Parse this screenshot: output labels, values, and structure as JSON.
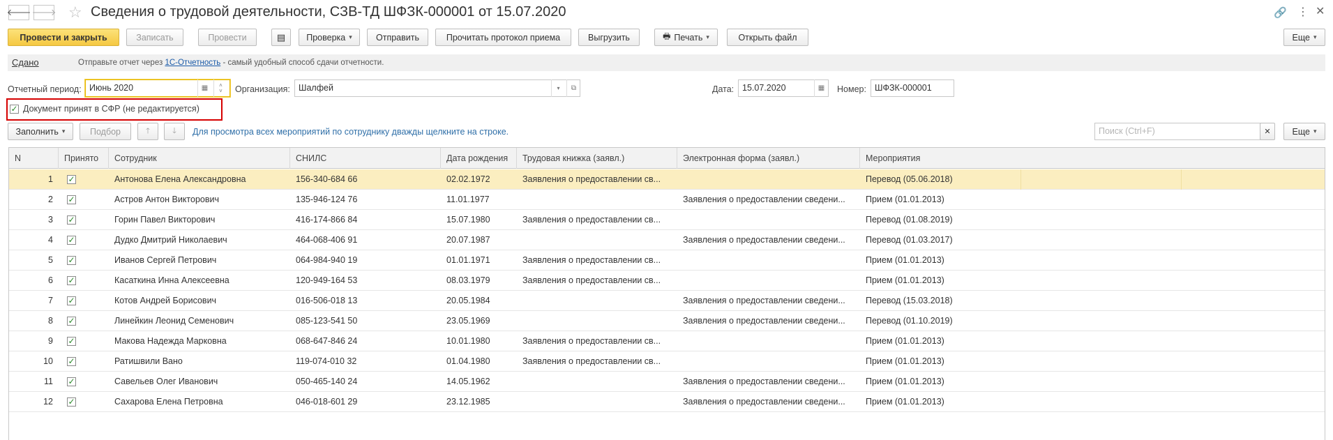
{
  "title": "Сведения о трудовой деятельности, СЗВ-ТД ШФЗК-000001 от 15.07.2020",
  "toolbar": {
    "post_close": "Провести и закрыть",
    "save": "Записать",
    "post": "Провести",
    "check": "Проверка",
    "send": "Отправить",
    "read_protocol": "Прочитать протокол приема",
    "upload": "Выгрузить",
    "print": "Печать",
    "open_file": "Открыть файл",
    "more": "Еще"
  },
  "info": {
    "status": "Сдано",
    "text_before": "Отправьте отчет через",
    "link": "1С-Отчетность",
    "text_after": "- самый удобный способ сдачи отчетности."
  },
  "fields": {
    "period_label": "Отчетный период:",
    "period_value": "Июнь 2020",
    "org_label": "Организация:",
    "org_value": "Шалфей",
    "date_label": "Дата:",
    "date_value": "15.07.2020",
    "number_label": "Номер:",
    "number_value": "ШФЗК-000001"
  },
  "accepted_checkbox": "Документ принят в СФР (не редактируется)",
  "table_toolbar": {
    "fill": "Заполнить",
    "select": "Подбор",
    "hint": "Для просмотра всех мероприятий по сотруднику дважды щелкните на строке.",
    "search_placeholder": "Поиск (Ctrl+F)",
    "more": "Еще"
  },
  "columns": [
    "N",
    "Принято",
    "Сотрудник",
    "СНИЛС",
    "Дата рождения",
    "Трудовая книжка (заявл.)",
    "Электронная форма (заявл.)",
    "Мероприятия"
  ],
  "rows": [
    {
      "n": "1",
      "name": "Антонова Елена Александровна",
      "snils": "156-340-684 66",
      "dob": "02.02.1972",
      "book": "Заявления о предоставлении св...",
      "eform": "",
      "event": "Перевод (05.06.2018)"
    },
    {
      "n": "2",
      "name": "Астров Антон Викторович",
      "snils": "135-946-124 76",
      "dob": "11.01.1977",
      "book": "",
      "eform": "Заявления о предоставлении сведени...",
      "event": "Прием (01.01.2013)"
    },
    {
      "n": "3",
      "name": "Горин Павел Викторович",
      "snils": "416-174-866 84",
      "dob": "15.07.1980",
      "book": "Заявления о предоставлении св...",
      "eform": "",
      "event": "Перевод (01.08.2019)"
    },
    {
      "n": "4",
      "name": "Дудко Дмитрий Николаевич",
      "snils": "464-068-406 91",
      "dob": "20.07.1987",
      "book": "",
      "eform": "Заявления о предоставлении сведени...",
      "event": "Перевод (01.03.2017)"
    },
    {
      "n": "5",
      "name": "Иванов Сергей Петрович",
      "snils": "064-984-940 19",
      "dob": "01.01.1971",
      "book": "Заявления о предоставлении св...",
      "eform": "",
      "event": "Прием (01.01.2013)"
    },
    {
      "n": "6",
      "name": "Касаткина Инна Алексеевна",
      "snils": "120-949-164 53",
      "dob": "08.03.1979",
      "book": "Заявления о предоставлении св...",
      "eform": "",
      "event": "Прием (01.01.2013)"
    },
    {
      "n": "7",
      "name": "Котов Андрей Борисович",
      "snils": "016-506-018 13",
      "dob": "20.05.1984",
      "book": "",
      "eform": "Заявления о предоставлении сведени...",
      "event": "Перевод (15.03.2018)"
    },
    {
      "n": "8",
      "name": "Линейкин Леонид Семенович",
      "snils": "085-123-541 50",
      "dob": "23.05.1969",
      "book": "",
      "eform": "Заявления о предоставлении сведени...",
      "event": "Перевод (01.10.2019)"
    },
    {
      "n": "9",
      "name": "Макова Надежда Марковна",
      "snils": "068-647-846 24",
      "dob": "10.01.1980",
      "book": "Заявления о предоставлении св...",
      "eform": "",
      "event": "Прием (01.01.2013)"
    },
    {
      "n": "10",
      "name": "Ратишвили Вано",
      "snils": "119-074-010 32",
      "dob": "01.04.1980",
      "book": "Заявления о предоставлении св...",
      "eform": "",
      "event": "Прием (01.01.2013)"
    },
    {
      "n": "11",
      "name": "Савельев Олег Иванович",
      "snils": "050-465-140 24",
      "dob": "14.05.1962",
      "book": "",
      "eform": "Заявления о предоставлении сведени...",
      "event": "Прием (01.01.2013)"
    },
    {
      "n": "12",
      "name": "Сахарова Елена Петровна",
      "snils": "046-018-601 29",
      "dob": "23.12.1985",
      "book": "",
      "eform": "Заявления о предоставлении сведени...",
      "event": "Прием (01.01.2013)"
    }
  ]
}
